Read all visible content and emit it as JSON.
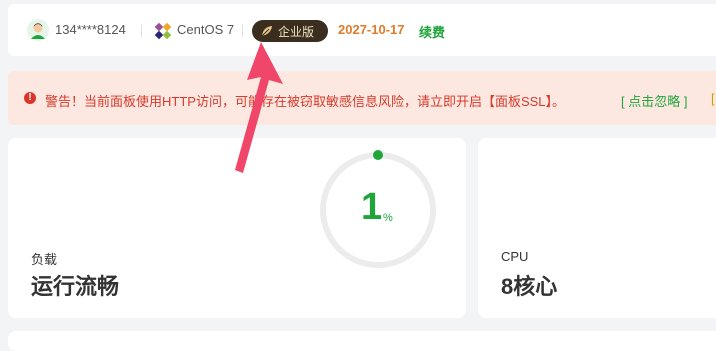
{
  "topbar": {
    "phone": "134****8124",
    "os": "CentOS 7",
    "edition": "企业版",
    "expire_date": "2027-10-17",
    "renew_label": "续费"
  },
  "warning": {
    "text": "警告！当前面板使用HTTP访问，可能存在被窃取敏感信息风险，请立即开启【面板SSL】。",
    "ignore_label": "[ 点击忽略 ]",
    "more_label": "["
  },
  "cards": {
    "load": {
      "label": "负载",
      "status": "运行流畅",
      "percent": "1",
      "unit": "%"
    },
    "cpu": {
      "label": "CPU",
      "value": "8核心"
    }
  },
  "colors": {
    "accent_green": "#20a53a",
    "warning_red": "#d63a2b",
    "expire_orange": "#e07b2b",
    "arrow_pink": "#f0466a"
  }
}
